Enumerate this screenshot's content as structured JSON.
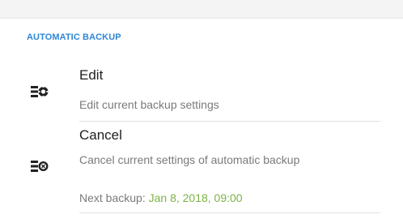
{
  "section": {
    "header": "AUTOMATIC BACKUP"
  },
  "items": [
    {
      "title": "Edit",
      "subtitle": "Edit current backup settings",
      "icon": "backup-settings-icon"
    },
    {
      "title": "Cancel",
      "subtitle": "Cancel current settings of automatic backup",
      "icon": "backup-cancel-icon"
    }
  ],
  "next_backup": {
    "label": "Next backup:",
    "value": "Jan 8, 2018, 09:00",
    "value_color": "#7cb342"
  },
  "colors": {
    "header": "#2f86d6",
    "title": "#212121",
    "subtitle": "#7a7a7a"
  }
}
